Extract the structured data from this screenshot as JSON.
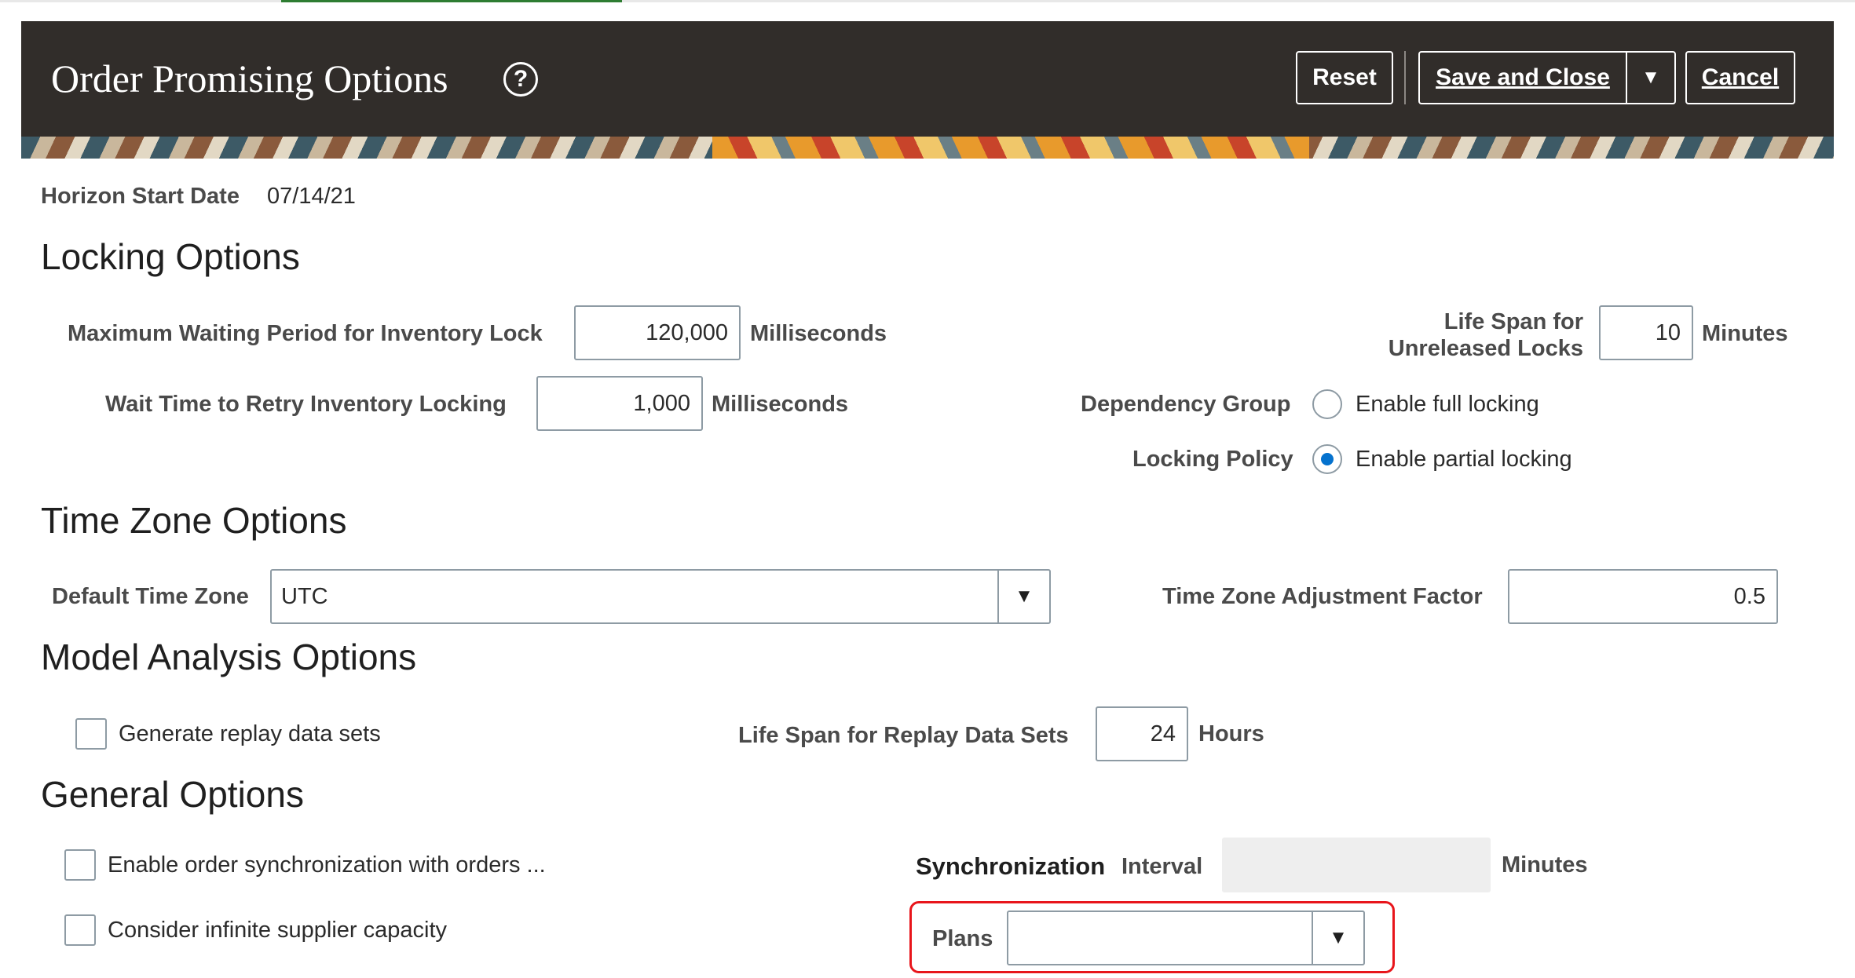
{
  "header": {
    "title": "Order Promising Options",
    "help_icon": "question-circle-icon",
    "reset_label": "Reset",
    "save_close_label": "Save and Close",
    "save_close_menu_icon": "caret-down-icon",
    "cancel_label": "Cancel"
  },
  "horizon": {
    "label": "Horizon Start Date",
    "value": "07/14/21"
  },
  "locking": {
    "heading": "Locking Options",
    "max_wait_label": "Maximum Waiting Period for Inventory Lock",
    "max_wait_value": "120,000",
    "max_wait_unit": "Milliseconds",
    "retry_label": "Wait Time to Retry Inventory Locking",
    "retry_value": "1,000",
    "retry_unit": "Milliseconds",
    "life_span_label_line1": "Life Span for",
    "life_span_label_line2": "Unreleased Locks",
    "life_span_value": "10",
    "life_span_unit": "Minutes",
    "dependency_group_label": "Dependency Group",
    "full_locking_label": "Enable full locking",
    "locking_policy_label": "Locking Policy",
    "partial_locking_label": "Enable partial locking",
    "selected_policy": "Enable partial locking"
  },
  "timezone": {
    "heading": "Time Zone Options",
    "default_label": "Default Time Zone",
    "default_value": "UTC",
    "adjustment_label": "Time Zone Adjustment Factor",
    "adjustment_value": "0.5"
  },
  "model": {
    "heading": "Model Analysis Options",
    "replay_label": "Generate replay data sets",
    "replay_checked": false,
    "replay_life_label": "Life Span for Replay Data Sets",
    "replay_life_value": "24",
    "replay_life_unit": "Hours"
  },
  "general": {
    "heading": "General Options",
    "sync_orders_label": "Enable order synchronization with orders ...",
    "sync_orders_checked": false,
    "infinite_capacity_label": "Consider infinite supplier capacity",
    "infinite_capacity_checked": false,
    "sync_word": "Synchronization",
    "interval_word": "Interval",
    "interval_value": "",
    "interval_unit": "Minutes",
    "plans_label": "Plans",
    "plans_value": ""
  },
  "colors": {
    "header_bg": "#312d2a",
    "radio_selected": "#0572ce",
    "highlight_border": "#e8151b"
  }
}
